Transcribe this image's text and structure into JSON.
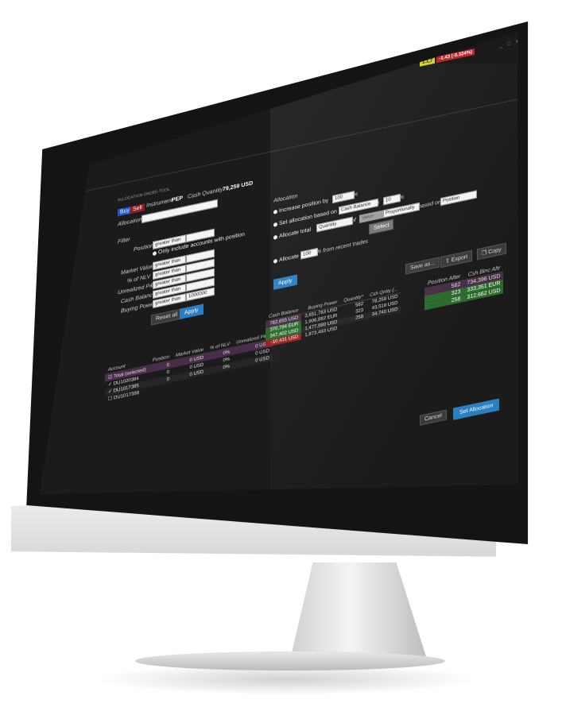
{
  "ticker": {
    "price": "1.1,7",
    "change": "-1.43 (-0.324%)"
  },
  "window": {
    "title": "ALLOCATION ORDER TOOL",
    "controls": "_ □ ✕"
  },
  "order": {
    "buy_label": "Buy",
    "sell_label": "Sell",
    "instrument_label": "Instrument",
    "instrument_value": "PEP",
    "cash_qty_label": "Cash Quantity",
    "cash_qty_value": "79,259 USD",
    "allocation_label": "Allocation",
    "allocation_value": ""
  },
  "filter": {
    "title": "Filter",
    "position_label": "Position",
    "position_op": "greater than",
    "only_include": "Only include accounts with position",
    "market_value_label": "Market Value",
    "market_value_op": "greater than",
    "nlv_label": "% of NLV",
    "nlv_op": "greater than",
    "unrealized_label": "Unrealized P&L",
    "unrealized_op": "greater than",
    "cash_balance_label": "Cash Balance",
    "cash_balance_op": "greater than",
    "buying_power_label": "Buying Power",
    "buying_power_op": "greater than",
    "buying_power_val": "1000000",
    "reset_label": "Reset all",
    "apply_label": "Apply"
  },
  "allocation": {
    "title": "Allocation",
    "opt1_a": "Increase position by",
    "opt1_val": "100",
    "opt1_unit": "%",
    "opt2_a": "Set allocation based on",
    "opt2_sel": "Cash Balance",
    "opt2_x": "x",
    "opt2_val": "10",
    "opt2_unit": "%",
    "opt3_a": "Allocate total",
    "opt3_sel": "Quantity",
    "opt3_of": "of",
    "opt3_val": "Value",
    "opt3_sel2": "Proportionally",
    "opt3_based": "based on",
    "opt3_sel3": "Position",
    "opt3_select": "Select",
    "opt4_a": "Allocate",
    "opt4_val": "100",
    "opt4_b": "% from recent trades",
    "apply_label": "Apply"
  },
  "actions": {
    "save_as": "Save as...",
    "export": "Export",
    "copy": "Copy"
  },
  "left_table": {
    "headers": [
      "Account",
      "Position",
      "Market Value",
      "% of NLV",
      "Unrealized P&L"
    ],
    "rows": [
      [
        "Total (selected)",
        "0",
        "0 USD",
        "0%",
        "0 USD"
      ],
      [
        "DU1020384",
        "0",
        "0 USD",
        "0%",
        "0 USD"
      ],
      [
        "DU1017385",
        "0",
        "0 USD",
        "0%",
        "0 USD"
      ],
      [
        "DU1017388",
        "",
        "",
        "",
        ""
      ]
    ]
  },
  "mid_table": {
    "headers": [
      "Cash Balance",
      "Buying Power",
      "Quantity*",
      "Csh Qntty (..."
    ],
    "rows": [
      [
        "782,655 USD",
        "3,651,783 USD",
        "582",
        "78,259 USD"
      ],
      [
        "370,784 EUR",
        "1,906,882 EUR",
        "323",
        "43,519 USD"
      ],
      [
        "347,402 USD",
        "1,477,980 USD",
        "258",
        "34,740 USD"
      ],
      [
        "-10,431 USD",
        "1,873,493 USD",
        "",
        ""
      ]
    ]
  },
  "right_table": {
    "headers": [
      "Position After",
      "Csh Blnc Aftr"
    ],
    "rows": [
      [
        "582",
        "734,396 USD"
      ],
      [
        "323",
        "333,351 EUR"
      ],
      [
        "258",
        "312,662 USD"
      ]
    ]
  },
  "footer": {
    "cancel": "Cancel",
    "set_allocation": "Set Allocation"
  },
  "colors": {
    "accent": "#2a7fc1",
    "buy": "#2255cc",
    "sell": "#8c1f1f",
    "positive": "#2d6b2d",
    "negative": "#9a2323"
  }
}
